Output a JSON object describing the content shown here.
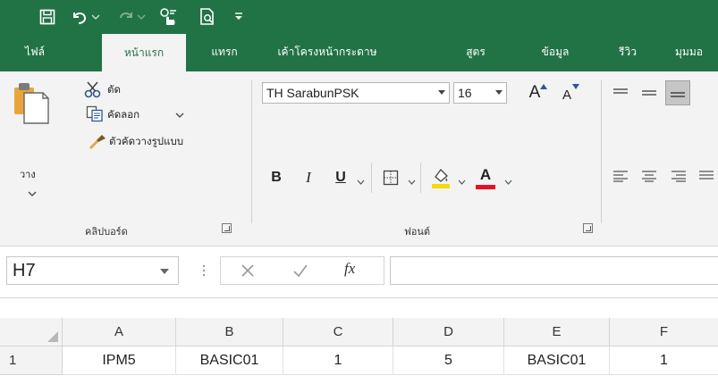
{
  "colors": {
    "brand": "#217346",
    "ribbon": "#f3f3f3",
    "underline_red": "#e81123",
    "fill_yellow": "#f5d90f"
  },
  "qat": {
    "icons": [
      "save-icon",
      "undo-icon",
      "redo-icon",
      "touch-mode-icon",
      "print-preview-icon",
      "customize-qat-icon"
    ]
  },
  "tabs": [
    {
      "label": "ไฟล์"
    },
    {
      "label": "หน้าแรก"
    },
    {
      "label": "แทรก"
    },
    {
      "label": "เค้าโครงหน้ากระดาษ"
    },
    {
      "label": "สูตร"
    },
    {
      "label": "ข้อมูล"
    },
    {
      "label": "รีวิว"
    },
    {
      "label": "มุมมอ"
    }
  ],
  "clipboard": {
    "paste_label": "วาง",
    "cut_label": "ตัด",
    "copy_label": "คัดลอก",
    "format_painter_label": "ตัวคัดวางรูปแบบ",
    "group_label": "คลิปบอร์ด"
  },
  "font": {
    "font_name": "TH SarabunPSK",
    "font_size": "16",
    "bold": "B",
    "italic": "I",
    "underline": "U",
    "font_color_letter": "A",
    "grow_letter": "A",
    "shrink_letter": "A",
    "group_label": "ฟอนต์"
  },
  "formula_bar": {
    "name_box": "H7",
    "fx_label": "fx",
    "value": ""
  },
  "grid": {
    "columns": [
      "A",
      "B",
      "C",
      "D",
      "E",
      "F"
    ],
    "rows": [
      {
        "row_number": "1",
        "cells": [
          "IPM5",
          "BASIC01",
          "1",
          "5",
          "BASIC01",
          "1"
        ]
      }
    ]
  }
}
